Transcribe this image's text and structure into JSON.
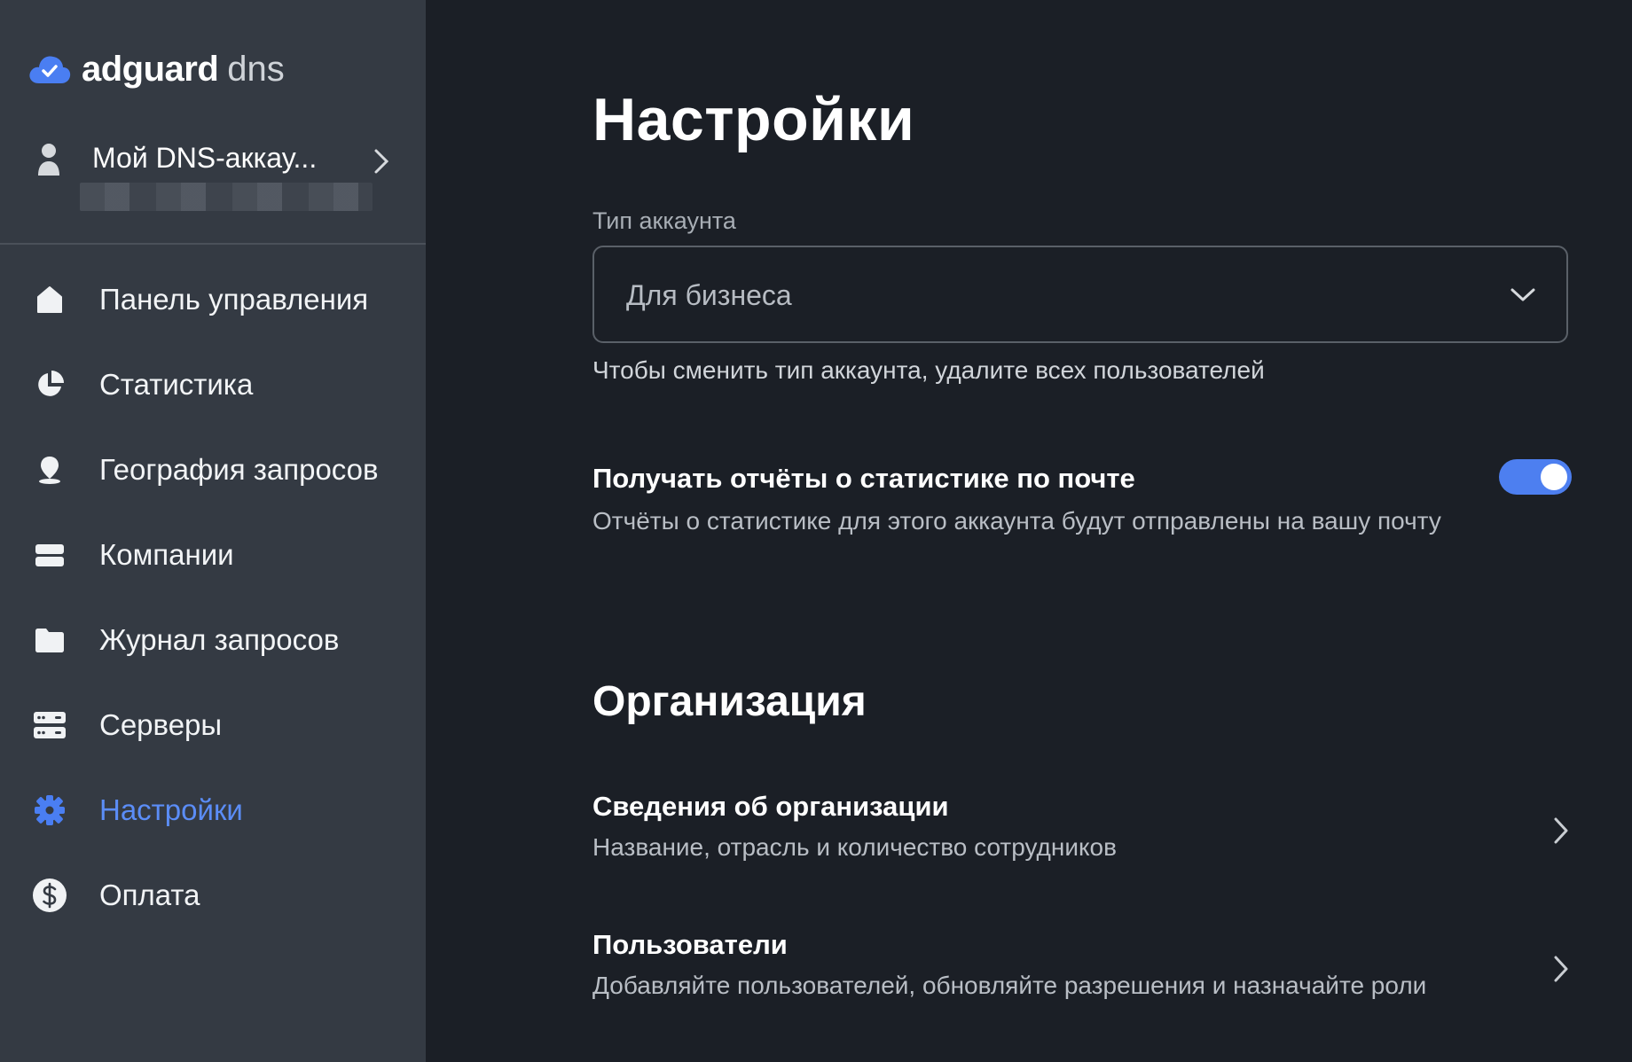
{
  "brand": {
    "name": "adguard",
    "product": "dns",
    "accent": "#4a7ef2"
  },
  "account": {
    "name": "Мой DNS-аккау..."
  },
  "sidebar": {
    "items": [
      {
        "label": "Панель управления",
        "icon": "home-icon",
        "active": false
      },
      {
        "label": "Статистика",
        "icon": "pie-chart-icon",
        "active": false
      },
      {
        "label": "География запросов",
        "icon": "location-pin-icon",
        "active": false
      },
      {
        "label": "Компании",
        "icon": "company-icon",
        "active": false
      },
      {
        "label": "Журнал запросов",
        "icon": "folder-icon",
        "active": false
      },
      {
        "label": "Серверы",
        "icon": "servers-icon",
        "active": false
      },
      {
        "label": "Настройки",
        "icon": "gear-icon",
        "active": true
      },
      {
        "label": "Оплата",
        "icon": "dollar-icon",
        "active": false
      }
    ]
  },
  "main": {
    "title": "Настройки",
    "account_type": {
      "label": "Тип аккаунта",
      "value": "Для бизнеса",
      "hint": "Чтобы сменить тип аккаунта, удалите всех пользователей"
    },
    "email_reports": {
      "title": "Получать отчёты о статистике по почте",
      "description": "Отчёты о статистике для этого аккаунта будут отправлены на вашу почту",
      "enabled": true,
      "toggle_color": "#4d7ff0"
    },
    "organization": {
      "title": "Организация",
      "rows": [
        {
          "title": "Сведения об организации",
          "description": "Название, отрасль и количество сотрудников"
        },
        {
          "title": "Пользователи",
          "description": "Добавляйте пользователей, обновляйте разрешения и назначайте роли"
        }
      ]
    }
  }
}
